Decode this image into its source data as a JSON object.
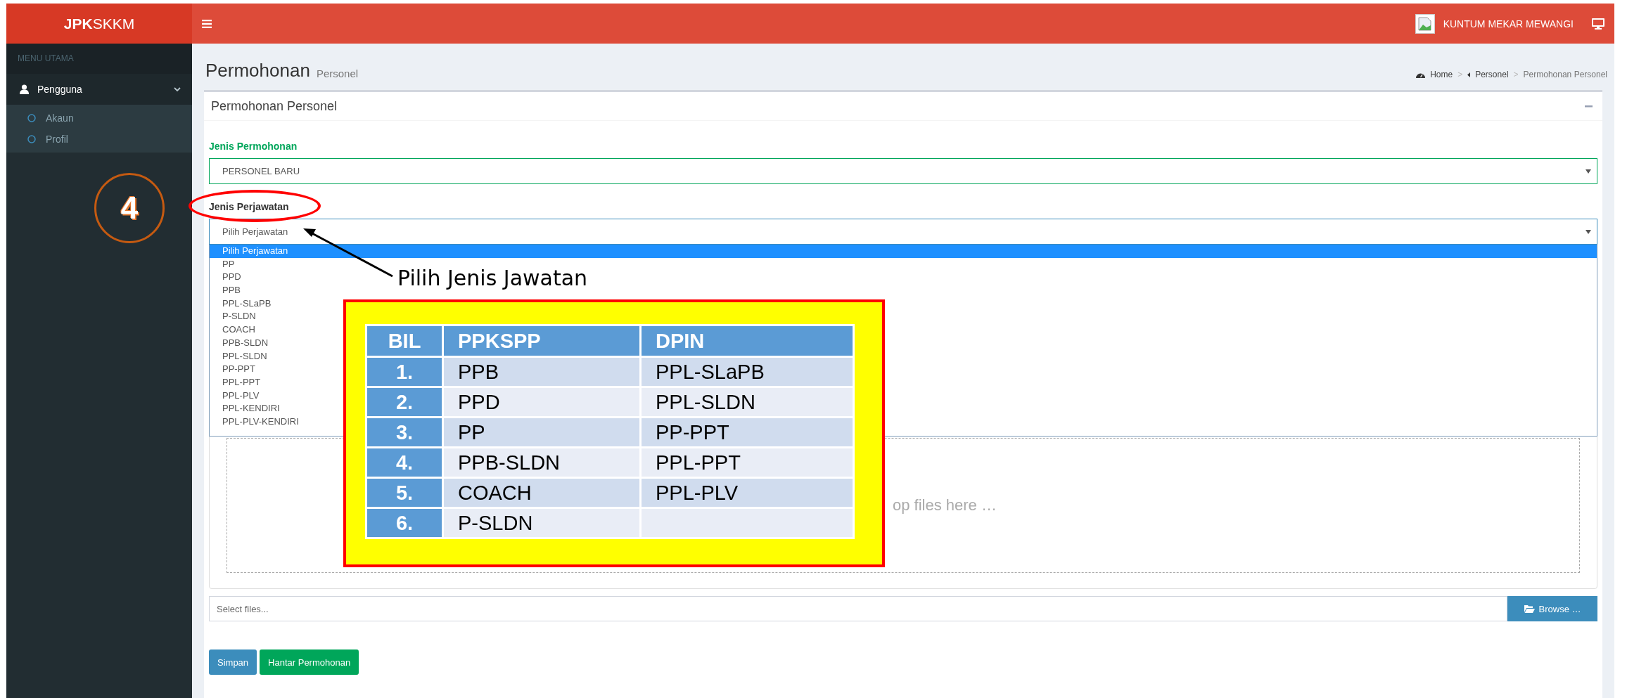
{
  "brand": "**JPK**SKKM",
  "header": {
    "user": "KUNTUM MEKAR MEWANGI"
  },
  "sidebar": {
    "section": "MENU UTAMA",
    "items": [
      {
        "label": "Pengguna",
        "expanded": true,
        "children": [
          {
            "label": "Akaun"
          },
          {
            "label": "Profil"
          }
        ]
      }
    ]
  },
  "page": {
    "title": "Permohonan",
    "subtitle": "Personel",
    "breadcrumb": {
      "separator": ">",
      "items": [
        {
          "label": "Home",
          "kind": "home"
        },
        {
          "label": "Personel",
          "kind": "link"
        },
        {
          "label": "Permohonan Personel",
          "kind": "current"
        }
      ]
    }
  },
  "card": {
    "title": "Permohonan Personel",
    "fields": [
      {
        "label": "Jenis Permohonan",
        "value": "PERSONEL BARU",
        "valid": true,
        "focused": false
      },
      {
        "label": "Jenis Perjawatan",
        "value": "Pilih Perjawatan",
        "valid": false,
        "focused": true,
        "options": [
          {
            "label": "Pilih Perjawatan",
            "selected": true
          },
          {
            "label": "PP",
            "selected": false
          },
          {
            "label": "PPD",
            "selected": false
          },
          {
            "label": "PPB",
            "selected": false
          },
          {
            "label": "PPL-SLaPB",
            "selected": false
          },
          {
            "label": "P-SLDN",
            "selected": false
          },
          {
            "label": "COACH",
            "selected": false
          },
          {
            "label": "PPB-SLDN",
            "selected": false
          },
          {
            "label": "PPL-SLDN",
            "selected": false
          },
          {
            "label": "PP-PPT",
            "selected": false
          },
          {
            "label": "PPL-PPT",
            "selected": false
          },
          {
            "label": "PPL-PLV",
            "selected": false
          },
          {
            "label": "PPL-KENDIRI",
            "selected": false
          },
          {
            "label": "PPL-PLV-KENDIRI",
            "selected": false
          }
        ]
      }
    ],
    "dropzone": {
      "text": "op files here …"
    },
    "file_input": {
      "placeholder": "Select files...",
      "browse": "Browse …"
    },
    "buttons": [
      {
        "label": "Simpan",
        "kind": "primary"
      },
      {
        "label": "Hantar Permohonan",
        "kind": "success"
      }
    ]
  },
  "annotations": {
    "step": "4",
    "callout": "Pilih Jenis Jawatan",
    "table": {
      "columns": [
        "BIL",
        "PPKSPP",
        "DPIN"
      ],
      "rows": [
        [
          "1.",
          "PPB",
          "PPL-SLaPB"
        ],
        [
          "2.",
          "PPD",
          "PPL-SLDN"
        ],
        [
          "3.",
          "PP",
          "PP-PPT"
        ],
        [
          "4.",
          "PPB-SLDN",
          "PPL-PPT"
        ],
        [
          "5.",
          "COACH",
          "PPL-PLV"
        ],
        [
          "6.",
          "P-SLDN",
          ""
        ]
      ]
    }
  }
}
